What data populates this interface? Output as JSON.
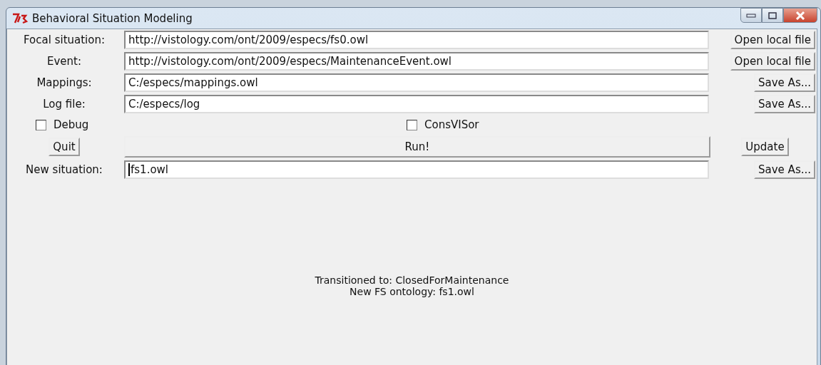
{
  "window": {
    "title": "Behavioral Situation Modeling"
  },
  "rows": [
    {
      "label": "Focal situation:",
      "value": "http://vistology.com/ont/2009/especs/fs0.owl",
      "button": "Open local file"
    },
    {
      "label": "Event:",
      "value": "http://vistology.com/ont/2009/especs/MaintenanceEvent.owl",
      "button": "Open local file"
    },
    {
      "label": "Mappings:",
      "value": "C:/especs/mappings.owl",
      "button": "Save As..."
    },
    {
      "label": "Log file:",
      "value": "C:/especs/log",
      "button": "Save As..."
    }
  ],
  "checkboxes": [
    {
      "label": "Debug",
      "checked": false
    },
    {
      "label": "ConsVISor",
      "checked": false
    }
  ],
  "actions": {
    "quit": "Quit",
    "run": "Run!",
    "update": "Update"
  },
  "new_situation": {
    "label": "New situation:",
    "value": "fs1.owl",
    "button": "Save As..."
  },
  "status": [
    "Transitioned to: ClosedForMaintenance",
    "New FS ontology: fs1.owl"
  ]
}
